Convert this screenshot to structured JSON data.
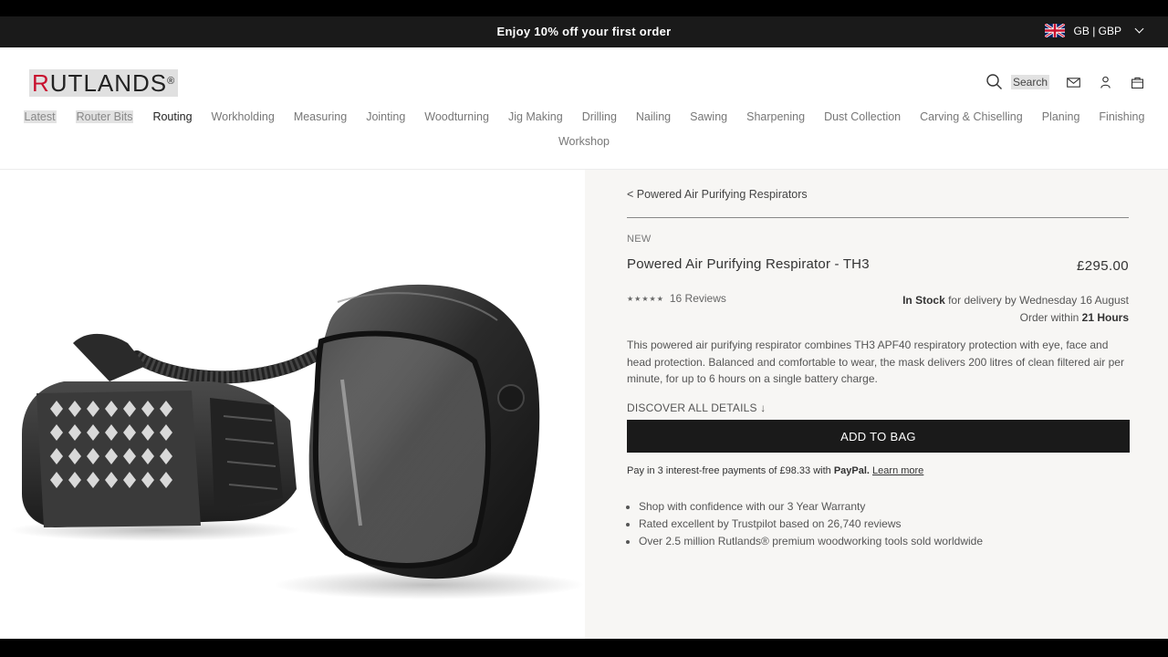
{
  "promo": {
    "message": "Enjoy 10% off your first order",
    "region": "GB | GBP",
    "flag_icon": "uk-flag-icon"
  },
  "header": {
    "logo_letter": "R",
    "logo_rest": "UTLANDS",
    "logo_mark": "®",
    "search_label": "Search",
    "icons": [
      "search-icon",
      "mail-icon",
      "account-icon",
      "bag-icon"
    ]
  },
  "nav": {
    "row1": [
      "Latest",
      "Router Bits",
      "Routing",
      "Workholding",
      "Measuring",
      "Jointing",
      "Woodturning",
      "Jig Making",
      "Drilling",
      "Nailing",
      "Sawing",
      "Sharpening",
      "Dust Collection",
      "Carving & Chiselling",
      "Planing",
      "Finishing"
    ],
    "row2": [
      "Workshop"
    ]
  },
  "product": {
    "back_link": "< Powered Air Purifying Respirators",
    "badge": "NEW",
    "title": "Powered Air Purifying Respirator - TH3",
    "price": "£295.00",
    "stars": "★★★★★",
    "reviews": "16 Reviews",
    "stock_status": "In Stock",
    "delivery": " for delivery by Wednesday 16 August",
    "order_prefix": "Order within ",
    "order_time": "21 Hours",
    "description": "This powered air purifying respirator combines TH3 APF40 respiratory protection with eye, face and head protection. Balanced and comfortable to wear, the mask delivers 200 litres of clean filtered air per minute, for up to 6 hours on a single battery charge.",
    "discover": "DISCOVER ALL DETAILS ↓",
    "add_to_bag": "ADD TO BAG",
    "paypal_text": "Pay in 3 interest-free payments of £98.33 with ",
    "paypal_brand": "PayPal.",
    "paypal_link": "Learn more",
    "bullets": [
      "Shop with confidence with our 3 Year Warranty",
      "Rated excellent by Trustpilot based on 26,740 reviews",
      "Over 2.5 million Rutlands® premium woodworking tools sold worldwide"
    ]
  },
  "colors": {
    "promo_bg": "#1a1a1a",
    "logo_red": "#c8102e",
    "button_bg": "#1a1a1a",
    "panel_bg": "#f7f6f4"
  }
}
